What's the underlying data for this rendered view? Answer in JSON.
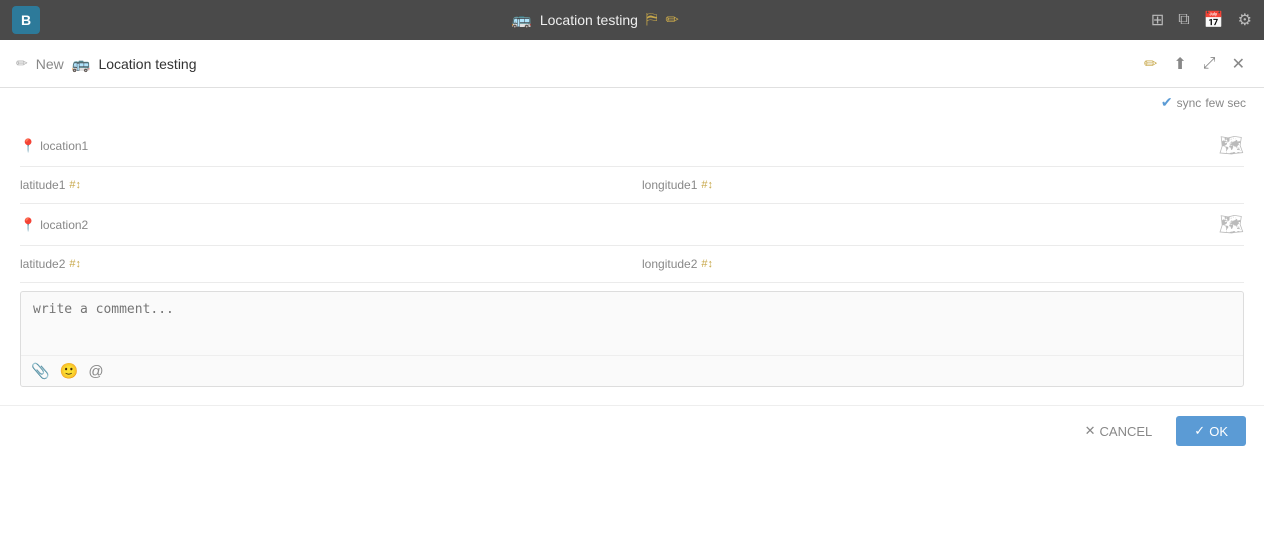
{
  "topbar": {
    "app_logo": "B",
    "title": "Location testing",
    "title_icon": "🚌",
    "filter_icon": "⛿",
    "edit_icon": "✏",
    "right_icons": [
      "grid",
      "window",
      "calendar",
      "settings"
    ]
  },
  "secondary_header": {
    "new_icon": "✏",
    "new_label": "New",
    "breadcrumb_icon": "🚌",
    "breadcrumb_label": "Location testing",
    "edit_icon": "✏",
    "share_icon": "⬆",
    "expand_icon": "⤢",
    "close_icon": "✕"
  },
  "sync": {
    "label": "sync",
    "time": "few sec"
  },
  "form": {
    "location1": {
      "label": "location1",
      "pin_icon": "📍",
      "map_icon": "🗺",
      "value": ""
    },
    "latitude1": {
      "label": "latitude1",
      "hash_icon": "#",
      "value": ""
    },
    "longitude1": {
      "label": "longitude1",
      "hash_icon": "#",
      "value": ""
    },
    "location2": {
      "label": "location2",
      "pin_icon": "📍",
      "map_icon": "🗺",
      "value": ""
    },
    "latitude2": {
      "label": "latitude2",
      "hash_icon": "#",
      "value": ""
    },
    "longitude2": {
      "label": "longitude2",
      "hash_icon": "#",
      "value": ""
    }
  },
  "comment": {
    "placeholder": "write a comment...",
    "attach_icon": "📎",
    "emoji_icon": "🙂",
    "mention_icon": "@"
  },
  "footer": {
    "cancel_icon": "✕",
    "cancel_label": "CANCEL",
    "ok_icon": "✓",
    "ok_label": "OK"
  }
}
